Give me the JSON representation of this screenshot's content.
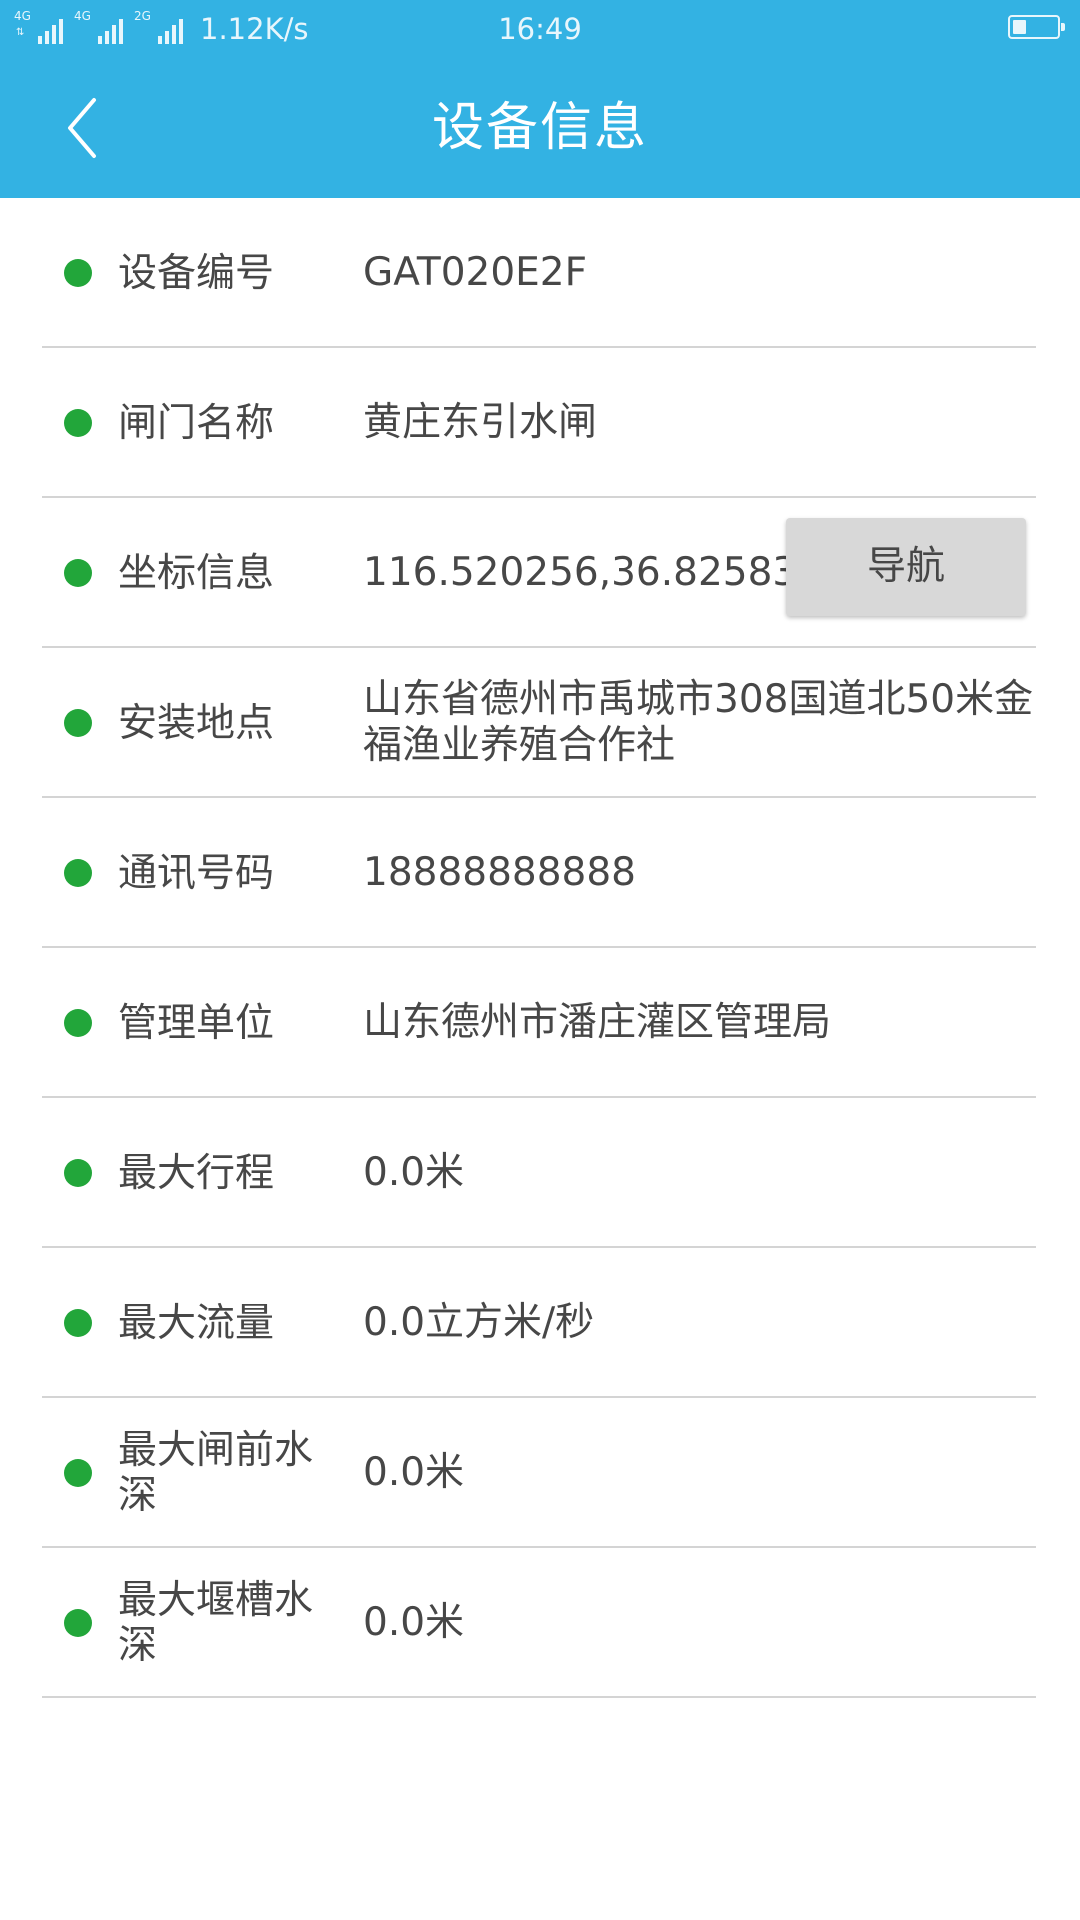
{
  "status_bar": {
    "network_1": "4G",
    "network_2": "4G",
    "network_3": "2G",
    "speed": "1.12K/s",
    "time": "16:49",
    "battery_level": 0.3
  },
  "header": {
    "title": "设备信息"
  },
  "navigate_button": "导航",
  "rows": [
    {
      "label": "设备编号",
      "value": "GAT020E2F"
    },
    {
      "label": "闸门名称",
      "value": "黄庄东引水闸"
    },
    {
      "label": "坐标信息",
      "value": "116.520256,36.825832"
    },
    {
      "label": "安装地点",
      "value": "山东省德州市禹城市308国道北50米金福渔业养殖合作社"
    },
    {
      "label": "通讯号码",
      "value": "18888888888"
    },
    {
      "label": "管理单位",
      "value": "山东德州市潘庄灌区管理局"
    },
    {
      "label": "最大行程",
      "value": "0.0米"
    },
    {
      "label": "最大流量",
      "value": "0.0立方米/秒"
    },
    {
      "label_line1": "最大闸前水",
      "label_line2": "深",
      "value": "0.0米"
    },
    {
      "label_line1": "最大堰槽水",
      "label_line2": "深",
      "value": "0.0米"
    }
  ],
  "colors": {
    "header_bg": "#33b2e3",
    "dot": "#22a63a",
    "divider": "#d4d4d4",
    "text": "#474747",
    "button_bg": "#d8d8d8"
  }
}
